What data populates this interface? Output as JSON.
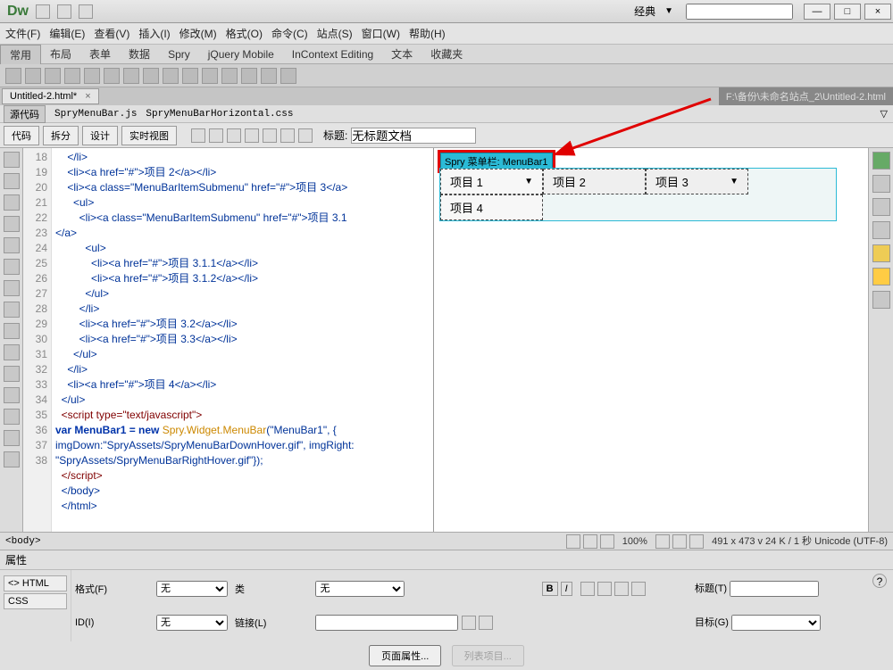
{
  "app_logo": "Dw",
  "layout_mode": "经典",
  "window_controls": {
    "min": "—",
    "max": "□",
    "close": "×"
  },
  "menubar": [
    "文件(F)",
    "编辑(E)",
    "查看(V)",
    "插入(I)",
    "修改(M)",
    "格式(O)",
    "命令(C)",
    "站点(S)",
    "窗口(W)",
    "帮助(H)"
  ],
  "tabbar": [
    "常用",
    "布局",
    "表单",
    "数据",
    "Spry",
    "jQuery Mobile",
    "InContext Editing",
    "文本",
    "收藏夹"
  ],
  "active_tab": "常用",
  "filetab": {
    "name": "Untitled-2.html*",
    "close": "×"
  },
  "file_path": "F:\\备份\\未命名站点_2\\Untitled-2.html",
  "source_row": {
    "btn": "源代码",
    "file1": "SpryMenuBar.js",
    "file2": "SpryMenuBarHorizontal.css"
  },
  "viewbar": {
    "code": "代码",
    "split": "拆分",
    "design": "设计",
    "live": "实时视图",
    "title_label": "标题:",
    "title_value": "无标题文档"
  },
  "gutter_lines": [
    "18",
    "19",
    "20",
    "21",
    "22",
    "",
    "23",
    "24",
    "25",
    "26",
    "27",
    "28",
    "29",
    "30",
    "31",
    "32",
    "33",
    "34",
    "35",
    "",
    "",
    "36",
    "37",
    "38",
    ""
  ],
  "spry_label": "Spry 菜单栏: MenuBar1",
  "menu": {
    "item1": "项目 1",
    "item2": "项目 2",
    "item3": "项目 3",
    "item4": "项目 4"
  },
  "status": {
    "tag": "<body>",
    "zoom": "100%",
    "info": "491 x 473 v  24 K / 1 秒  Unicode (UTF-8)"
  },
  "props": {
    "header": "属性",
    "html_btn": "<> HTML",
    "css_btn": "CSS",
    "format_lbl": "格式(F)",
    "format_val": "无",
    "class_lbl": "类",
    "class_val": "无",
    "id_lbl": "ID(I)",
    "id_val": "无",
    "link_lbl": "链接(L)",
    "title_lbl": "标题(T)",
    "target_lbl": "目标(G)",
    "page_props": "页面属性...",
    "list_items": "列表项目..."
  },
  "code": {
    "l18": "    </li>",
    "l19": "    <li><a href=\"#\">项目 2</a></li>",
    "l20": "    <li><a class=\"MenuBarItemSubmenu\" href=\"#\">项目 3</a>",
    "l21": "      <ul>",
    "l22": "        <li><a class=\"MenuBarItemSubmenu\" href=\"#\">项目 3.1",
    "l22b": "</a>",
    "l23": "          <ul>",
    "l24": "            <li><a href=\"#\">项目 3.1.1</a></li>",
    "l25": "            <li><a href=\"#\">项目 3.1.2</a></li>",
    "l26": "          </ul>",
    "l27": "        </li>",
    "l28": "        <li><a href=\"#\">项目 3.2</a></li>",
    "l29": "        <li><a href=\"#\">项目 3.3</a></li>",
    "l30": "      </ul>",
    "l31": "    </li>",
    "l32": "    <li><a href=\"#\">项目 4</a></li>",
    "l33": "  </ul>",
    "l34": "  <script type=\"text/javascript\">",
    "l35a": "var MenuBar1 = new ",
    "l35b": "Spry.Widget.MenuBar",
    "l35c": "(\"MenuBar1\", {",
    "l35d": "imgDown:\"SpryAssets/SpryMenuBarDownHover.gif\", imgRight:",
    "l35e": "\"SpryAssets/SpryMenuBarRightHover.gif\"});",
    "l36": "  </script>",
    "l37": "  </body>",
    "l38": "  </html>"
  }
}
